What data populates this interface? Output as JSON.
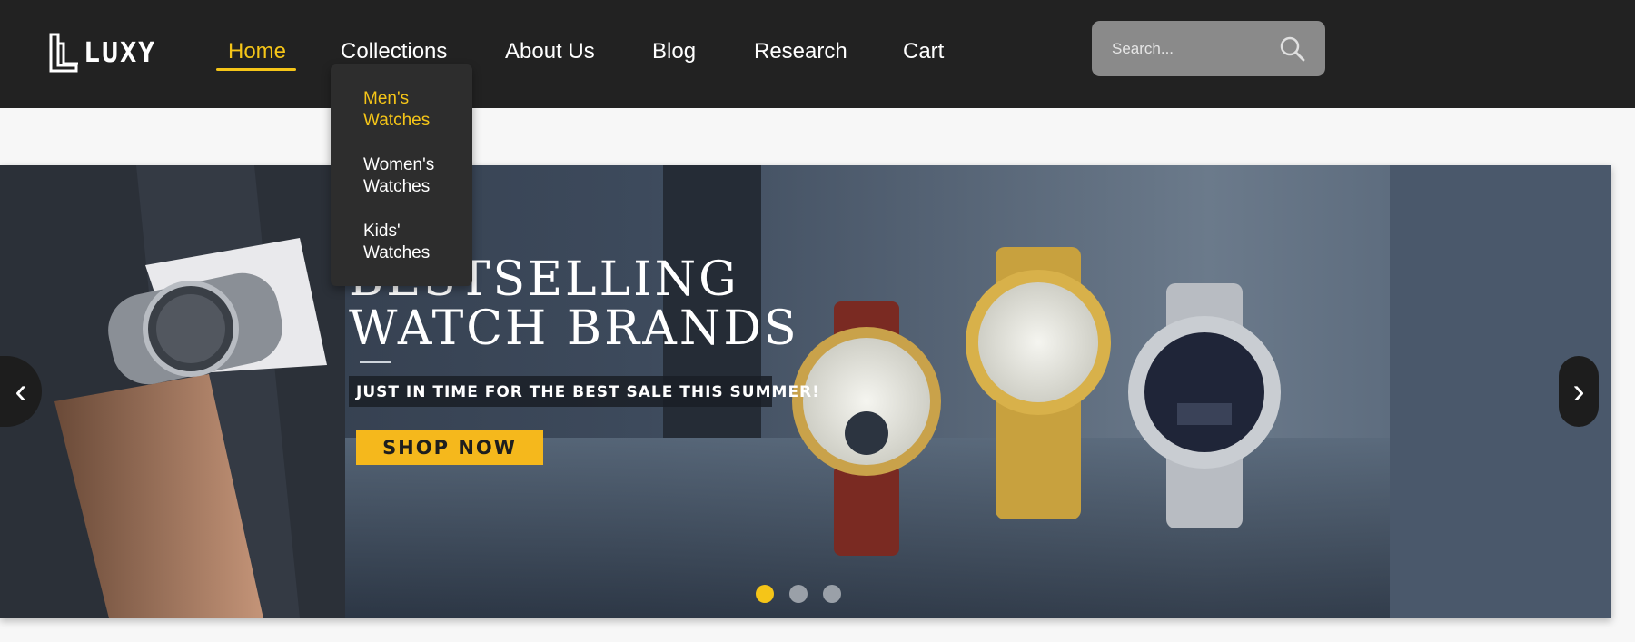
{
  "brand": {
    "name": "LUXY"
  },
  "nav": {
    "items": [
      {
        "label": "Home",
        "active": true
      },
      {
        "label": "Collections",
        "active": false
      },
      {
        "label": "About Us",
        "active": false
      },
      {
        "label": "Blog",
        "active": false
      },
      {
        "label": "Research",
        "active": false
      },
      {
        "label": "Cart",
        "active": false
      }
    ],
    "dropdown": [
      {
        "label": "Men's\nWatches",
        "active": true
      },
      {
        "label": "Women's\nWatches",
        "active": false
      },
      {
        "label": "Kids'\nWatches",
        "active": false
      }
    ]
  },
  "search": {
    "placeholder": "Search..."
  },
  "banner": {
    "headline_line1": "BESTSELLING",
    "headline_line2": "WATCH BRANDS",
    "tagline": "JUST IN TIME FOR THE BEST SALE THIS SUMMER!",
    "cta": "SHOP NOW",
    "prev_arrow": "‹",
    "next_arrow": "›",
    "slide_count": 3,
    "active_slide": 1
  },
  "colors": {
    "accent": "#f5c518",
    "nav_bg": "#222222",
    "cta_bg": "#f5b81c"
  },
  "icons": [
    "logo-icon",
    "search-icon",
    "chevron-left-icon",
    "chevron-right-icon"
  ]
}
